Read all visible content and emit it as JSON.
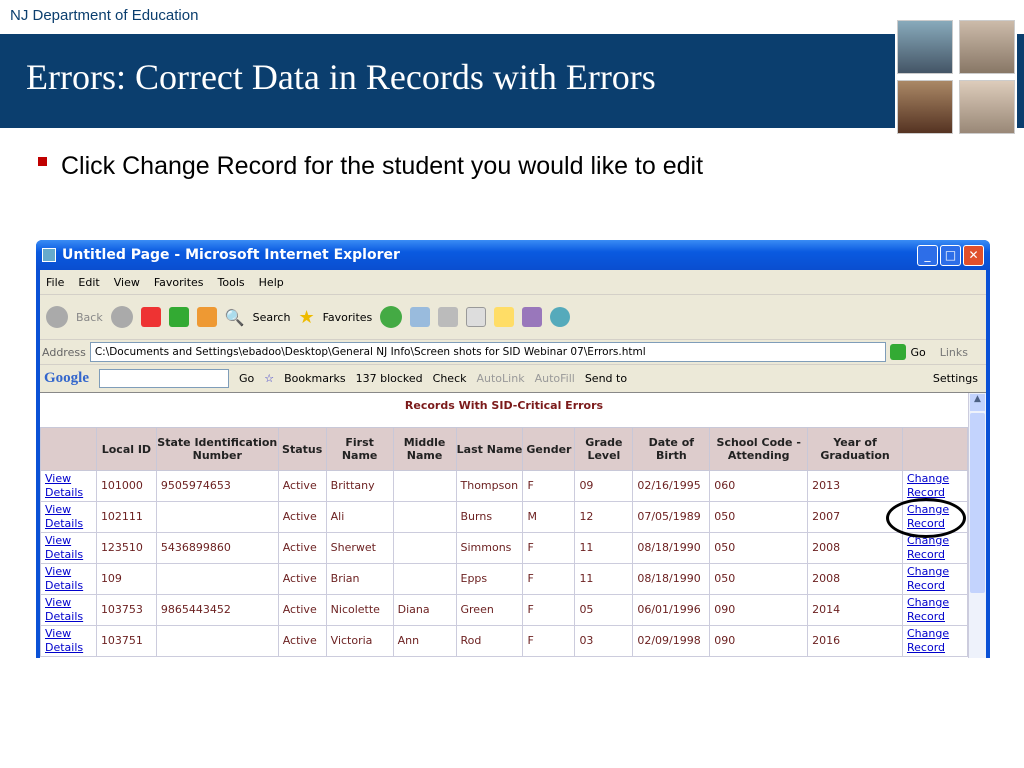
{
  "slide": {
    "org": "NJ Department of Education",
    "title": "Errors: Correct Data in Records with Errors",
    "bullet": "Click Change Record for the student you would like to edit"
  },
  "browser": {
    "title": "Untitled Page - Microsoft Internet Explorer",
    "menu": [
      "File",
      "Edit",
      "View",
      "Favorites",
      "Tools",
      "Help"
    ],
    "toolbar": {
      "back": "Back",
      "search": "Search",
      "favorites": "Favorites"
    },
    "address_label": "Address",
    "address": "C:\\Documents and Settings\\ebadoo\\Desktop\\General NJ Info\\Screen shots for SID Webinar 07\\Errors.html",
    "go": "Go",
    "links": "Links",
    "google": {
      "logo": "Google",
      "go": "Go",
      "bookmarks": "Bookmarks",
      "blocked": "137 blocked",
      "check": "Check",
      "autolink": "AutoLink",
      "autofill": "AutoFill",
      "sendto": "Send to",
      "settings": "Settings"
    }
  },
  "page": {
    "heading": "Records With SID-Critical Errors",
    "columns": [
      "",
      "Local ID",
      "State Identification Number",
      "Status",
      "First Name",
      "Middle Name",
      "Last Name",
      "Gender",
      "Grade Level",
      "Date of Birth",
      "School Code - Attending",
      "Year of Graduation",
      ""
    ],
    "view_link": [
      "View",
      "Details"
    ],
    "change_link": [
      "Change",
      "Record"
    ],
    "rows": [
      [
        "101000",
        "9505974653",
        "Active",
        "Brittany",
        "",
        "Thompson",
        "F",
        "09",
        "02/16/1995",
        "060",
        "2013"
      ],
      [
        "102111",
        "",
        "Active",
        "Ali",
        "",
        "Burns",
        "M",
        "12",
        "07/05/1989",
        "050",
        "2007"
      ],
      [
        "123510",
        "5436899860",
        "Active",
        "Sherwet",
        "",
        "Simmons",
        "F",
        "11",
        "08/18/1990",
        "050",
        "2008"
      ],
      [
        "109",
        "",
        "Active",
        "Brian",
        "",
        "Epps",
        "F",
        "11",
        "08/18/1990",
        "050",
        "2008"
      ],
      [
        "103753",
        "9865443452",
        "Active",
        "Nicolette",
        "Diana",
        "Green",
        "F",
        "05",
        "06/01/1996",
        "090",
        "2014"
      ],
      [
        "103751",
        "",
        "Active",
        "Victoria",
        "Ann",
        "Rod",
        "F",
        "03",
        "02/09/1998",
        "090",
        "2016"
      ]
    ]
  }
}
